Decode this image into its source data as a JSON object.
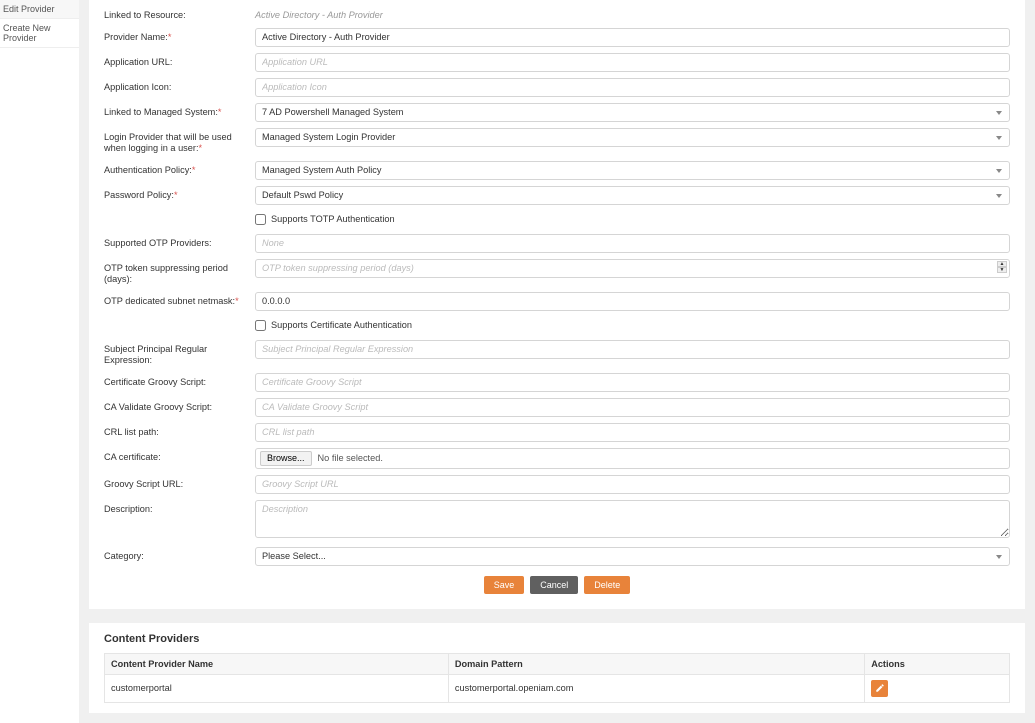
{
  "sidebar": {
    "items": [
      {
        "label": "Edit Provider"
      },
      {
        "label": "Create New Provider"
      }
    ]
  },
  "form": {
    "linked_resource_label": "Linked to Resource:",
    "linked_resource_value": "Active Directory - Auth Provider",
    "provider_name_label": "Provider Name:",
    "provider_name_value": "Active Directory - Auth Provider",
    "app_url_label": "Application URL:",
    "app_url_placeholder": "Application URL",
    "app_icon_label": "Application Icon:",
    "app_icon_placeholder": "Application Icon",
    "linked_mng_label": "Linked to Managed System:",
    "linked_mng_value": "7 AD Powershell Managed System",
    "login_provider_label": "Login Provider that will be used when logging in a user:",
    "login_provider_value": "Managed System Login Provider",
    "auth_policy_label": "Authentication Policy:",
    "auth_policy_value": "Managed System Auth Policy",
    "pwd_policy_label": "Password Policy:",
    "pwd_policy_value": "Default Pswd Policy",
    "totp_label": "Supports TOTP Authentication",
    "otp_providers_label": "Supported OTP Providers:",
    "otp_providers_placeholder": "None",
    "otp_suppress_label": "OTP token suppressing period (days):",
    "otp_suppress_placeholder": "OTP token suppressing period (days)",
    "otp_subnet_label": "OTP dedicated subnet netmask:",
    "otp_subnet_value": "0.0.0.0",
    "cert_auth_label": "Supports Certificate Authentication",
    "subj_regex_label": "Subject Principal Regular Expression:",
    "subj_regex_placeholder": "Subject Principal Regular Expression",
    "cert_groovy_label": "Certificate Groovy Script:",
    "cert_groovy_placeholder": "Certificate Groovy Script",
    "ca_validate_label": "CA Validate Groovy Script:",
    "ca_validate_placeholder": "CA Validate Groovy Script",
    "crl_path_label": "CRL list path:",
    "crl_path_placeholder": "CRL list path",
    "ca_cert_label": "CA certificate:",
    "browse_label": "Browse...",
    "no_file_label": "No file selected.",
    "groovy_url_label": "Groovy Script URL:",
    "groovy_url_placeholder": "Groovy Script URL",
    "description_label": "Description:",
    "description_placeholder": "Description",
    "category_label": "Category:",
    "category_value": "Please Select..."
  },
  "buttons": {
    "save": "Save",
    "cancel": "Cancel",
    "delete": "Delete"
  },
  "content_providers": {
    "title": "Content Providers",
    "columns": {
      "name": "Content Provider Name",
      "domain": "Domain Pattern",
      "actions": "Actions"
    },
    "rows": [
      {
        "name": "customerportal",
        "domain": "customerportal.openiam.com"
      }
    ]
  }
}
